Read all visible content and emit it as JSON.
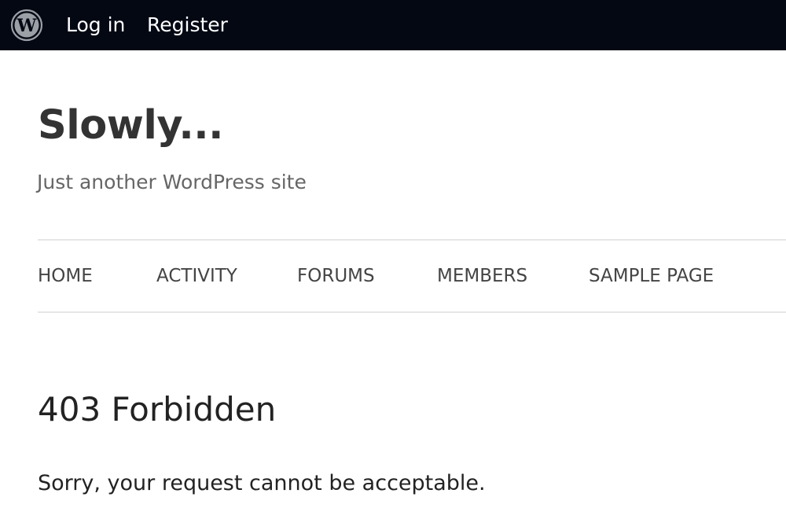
{
  "admin_bar": {
    "login_label": "Log in",
    "register_label": "Register"
  },
  "site": {
    "title": "Slowly...",
    "tagline": "Just another WordPress site"
  },
  "nav": {
    "items": [
      {
        "label": "HOME"
      },
      {
        "label": "ACTIVITY"
      },
      {
        "label": "FORUMS"
      },
      {
        "label": "MEMBERS"
      },
      {
        "label": "SAMPLE PAGE"
      }
    ]
  },
  "content": {
    "heading": "403 Forbidden",
    "message": "Sorry, your request cannot be acceptable."
  },
  "icons": {
    "logo": "wordpress-logo-icon"
  },
  "colors": {
    "admin_bar_bg": "#030813",
    "admin_bar_text": "#ffffff",
    "title_text": "#333333",
    "tagline_text": "#666666",
    "nav_text": "#444444",
    "divider": "#e6e6e6"
  }
}
